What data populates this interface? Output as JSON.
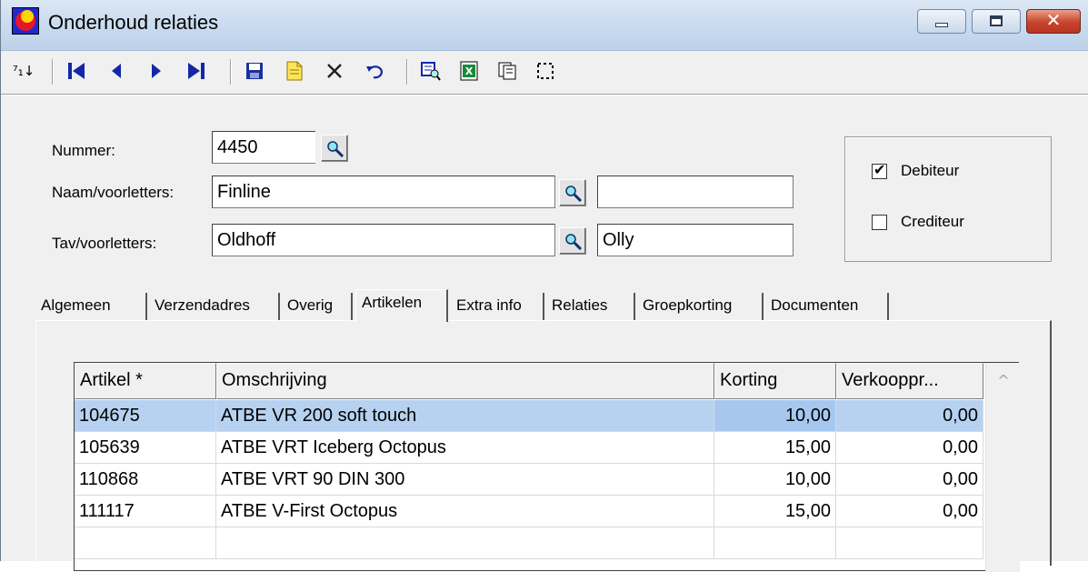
{
  "window": {
    "title": "Onderhoud relaties",
    "buttons": {
      "minimize": "",
      "maximize": "",
      "close": "✕"
    }
  },
  "toolbar": {
    "items": [
      "sort",
      "first",
      "previous",
      "next",
      "last",
      "save",
      "new",
      "delete",
      "undo",
      "search",
      "export-excel",
      "copy",
      "select"
    ],
    "sort_label": "⁷₁↓"
  },
  "form": {
    "nummer_label": "Nummer:",
    "nummer_value": "4450",
    "naam_label": "Naam/voorletters:",
    "naam_value": "Finline",
    "naam_voorletters_value": "",
    "tav_label": "Tav/voorletters:",
    "tav_value": "Oldhoff",
    "tav_voorletters_value": "Olly",
    "debiteur_label": "Debiteur",
    "debiteur_checked": true,
    "crediteur_label": "Crediteur",
    "crediteur_checked": false
  },
  "tabs": [
    {
      "label": "Algemeen"
    },
    {
      "label": "Verzendadres"
    },
    {
      "label": "Overig"
    },
    {
      "label": "Artikelen",
      "active": true
    },
    {
      "label": "Extra info"
    },
    {
      "label": "Relaties"
    },
    {
      "label": "Groepkorting"
    },
    {
      "label": "Documenten"
    }
  ],
  "grid": {
    "columns": [
      "Artikel *",
      "Omschrijving",
      "Korting",
      "Verkooppr..."
    ],
    "rows": [
      {
        "artikel": "104675",
        "omschrijving": "ATBE VR 200 soft touch",
        "korting": "10,00",
        "verkoopprijs": "0,00",
        "selected": true
      },
      {
        "artikel": "105639",
        "omschrijving": "ATBE VRT Iceberg Octopus",
        "korting": "15,00",
        "verkoopprijs": "0,00"
      },
      {
        "artikel": "110868",
        "omschrijving": "ATBE VRT 90 DIN 300",
        "korting": "10,00",
        "verkoopprijs": "0,00"
      },
      {
        "artikel": "111117",
        "omschrijving": "ATBE V-First Octopus",
        "korting": "15,00",
        "verkoopprijs": "0,00"
      }
    ],
    "scroll_up": "^"
  },
  "colors": {
    "selection": "#b7d1f0",
    "toolbar_icon": "#1328a6"
  }
}
